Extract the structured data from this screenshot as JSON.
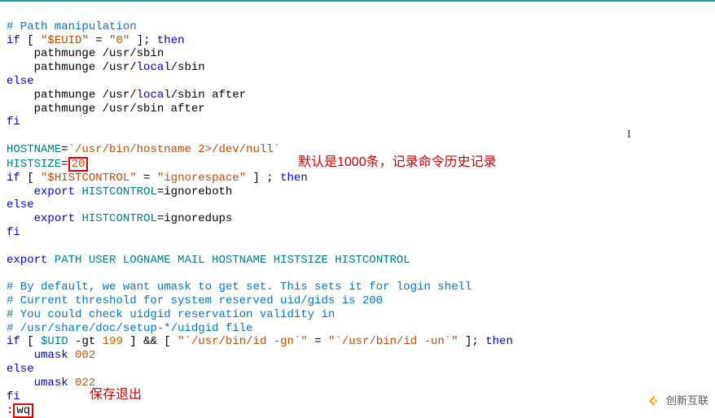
{
  "code": {
    "l1": "# Path manipulation",
    "l2a": "if",
    "l2b": " [ ",
    "l2c": "\"$EUID\"",
    "l2d": " = ",
    "l2e": "\"0\"",
    "l2f": " ]; ",
    "l2g": "then",
    "l3": "    pathmunge /usr/sbin",
    "l4a": "    pathmunge /usr/",
    "l4b": "local",
    "l4c": "/sbin",
    "l5": "else",
    "l6a": "    pathmunge /usr/",
    "l6b": "local",
    "l6c": "/sbin after",
    "l7": "    pathmunge /usr/sbin after",
    "l8": "fi",
    "l9a": "HOSTNAME",
    "l9b": "=",
    "l9c": "`/usr/bin/hostname 2>/dev/null`",
    "l10a": "HISTSIZE",
    "l10b": "=",
    "l10c": "20",
    "l11a": "if",
    "l11b": " [ ",
    "l11c": "\"$HISTCONTROL\"",
    "l11d": " = ",
    "l11e": "\"ignorespace\"",
    "l11f": " ] ; ",
    "l11g": "then",
    "l12a": "    ",
    "l12b": "export",
    "l12c": " ",
    "l12d": "HISTCONTROL",
    "l12e": "=ignoreboth",
    "l13": "else",
    "l14a": "    ",
    "l14b": "export",
    "l14c": " ",
    "l14d": "HISTCONTROL",
    "l14e": "=ignoredups",
    "l15": "fi",
    "l16a": "export",
    "l16b": " ",
    "l16c": "PATH USER LOGNAME MAIL HOSTNAME HISTSIZE HISTCONTROL",
    "l17": "# By default, we want umask to get set. This sets it for login shell",
    "l18": "# Current threshold for system reserved uid/gids is 200",
    "l19": "# You could check uidgid reservation validity in",
    "l20": "# /usr/share/doc/setup-*/uidgid file",
    "l21a": "if",
    "l21b": " [ ",
    "l21c": "$UID",
    "l21d": " -gt ",
    "l21e": "199",
    "l21f": " ] ",
    "l21g": "&&",
    "l21h": " [ ",
    "l21i": "\"`/usr/bin/id -gn`\"",
    "l21j": " = ",
    "l21k": "\"`/usr/bin/id -un`\"",
    "l21l": " ]; ",
    "l21m": "then",
    "l22a": "    ",
    "l22b": "umask",
    "l22c": " ",
    "l22d": "002",
    "l23": "else",
    "l24a": "    ",
    "l24b": "umask",
    "l24c": " ",
    "l24d": "022",
    "l25": "fi",
    "l26a": ":",
    "l26b": "wq"
  },
  "annotations": {
    "a1": "默认是1000条，记录命令历史记录",
    "a2": "保存退出"
  },
  "watermark": "创新互联"
}
